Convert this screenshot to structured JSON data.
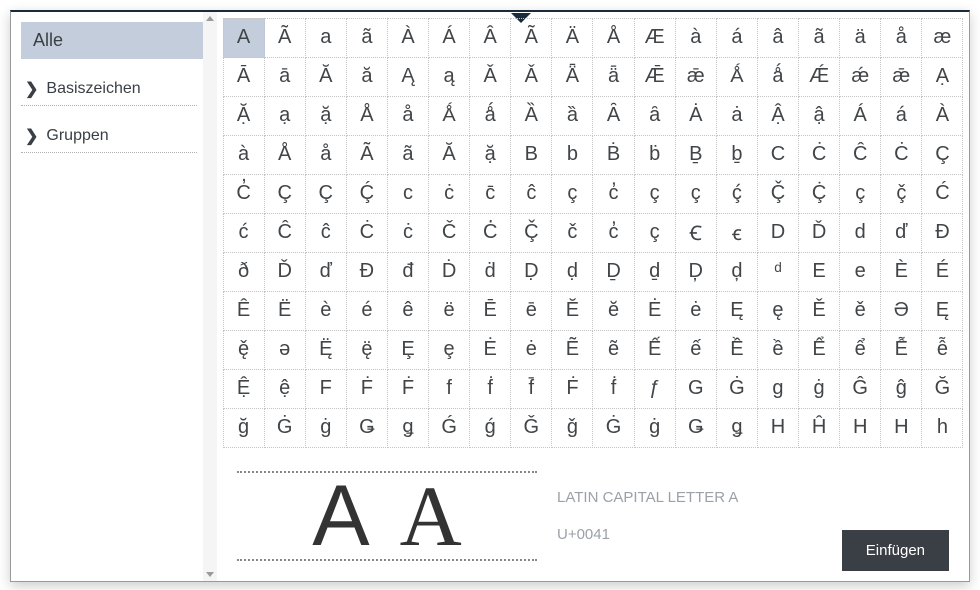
{
  "sidebar": {
    "categories": [
      {
        "label": "Alle",
        "selected": true
      }
    ],
    "collapse": [
      {
        "label": "Basiszeichen"
      },
      {
        "label": "Gruppen"
      }
    ]
  },
  "grid": {
    "selected_index": 0,
    "chars": [
      "A",
      "Ã",
      "a",
      "ã",
      "À",
      "Á",
      "Â",
      "Ã",
      "Ä",
      "Å",
      "Æ",
      "à",
      "á",
      "â",
      "ã",
      "ä",
      "å",
      "æ",
      "Ā",
      "ā",
      "Ă",
      "ă",
      "Ą",
      "ą",
      "Ǎ",
      "Ǎ",
      "Ǟ",
      "ǟ",
      "Ǣ",
      "ǣ",
      "Ǻ",
      "ǻ",
      "Ǽ",
      "ǽ",
      "ǣ",
      "Ạ",
      "Ặ",
      "ạ",
      "ặ",
      "Å",
      "å",
      "Ǻ",
      "ǻ",
      "Ȁ",
      "ȁ",
      "Ȃ",
      "ȃ",
      "Ȧ",
      "ȧ",
      "Ậ",
      "ậ",
      "Á",
      "á",
      "À",
      "à",
      "Å",
      "å",
      "Ã",
      "ã",
      "Ă",
      "ặ",
      "B",
      "b",
      "Ḃ",
      "ḃ",
      "Ḇ",
      "ḇ",
      "C",
      "Ċ",
      "Ĉ",
      "Ċ",
      "Ç",
      "C̓",
      "Ç",
      "Ç",
      "Ḉ",
      "c",
      "ċ",
      "c̄",
      "ĉ",
      "ç",
      "c̓",
      "ç",
      "ç",
      "ḉ",
      "Ç̌",
      "Ç̇",
      "ç",
      "ç̌",
      "Ć",
      "ć",
      "Ĉ",
      "ĉ",
      "Ċ",
      "ċ",
      "Č",
      "Ċ̇",
      "Ç̌",
      "č",
      "c̓",
      "ç",
      "Ꞓ",
      "ꞓ",
      "D",
      "Ď",
      "d",
      "ď",
      "Đ",
      "ð",
      "Ď",
      "ď",
      "Đ",
      "đ",
      "Ḋ",
      "ḋ",
      "Ḍ",
      "ḍ",
      "Ḏ",
      "ḏ",
      "Ḑ",
      "ḑ",
      "ᵈ",
      "E",
      "e",
      "È",
      "É",
      "Ê",
      "Ë",
      "è",
      "é",
      "ê",
      "ë",
      "Ē",
      "ē",
      "Ĕ",
      "ĕ",
      "Ė",
      "ė",
      "Ę",
      "ę",
      "Ě",
      "ě",
      "Ə",
      "Ę",
      "ę̌",
      "ə",
      "Ę̈",
      "ę̈",
      "Ȩ",
      "ȩ",
      "Ė",
      "ė",
      "Ẽ",
      "ẽ",
      "Ế",
      "ế",
      "Ề",
      "ề",
      "Ể",
      "ể",
      "Ễ",
      "ễ",
      "Ệ",
      "ệ",
      "F",
      "Ḟ",
      "Ḟ",
      "f",
      "ḟ",
      "f̄",
      "Ḟ",
      "ḟ",
      "ƒ",
      "G",
      "Ġ",
      "g",
      "ġ",
      "Ĝ",
      "ĝ",
      "Ğ",
      "ğ",
      "Ġ",
      "ġ",
      "Ǥ",
      "ǥ",
      "Ǵ",
      "ǵ",
      "Ǧ",
      "ǧ",
      "Ġ",
      "ġ",
      "Ǥ",
      "ǥ",
      "H",
      "Ĥ",
      "H",
      "H",
      "h"
    ]
  },
  "preview": {
    "char_name": "LATIN CAPITAL LETTER A",
    "codepoint": "U+0041",
    "glyph": "A"
  },
  "actions": {
    "insert_label": "Einfügen"
  }
}
